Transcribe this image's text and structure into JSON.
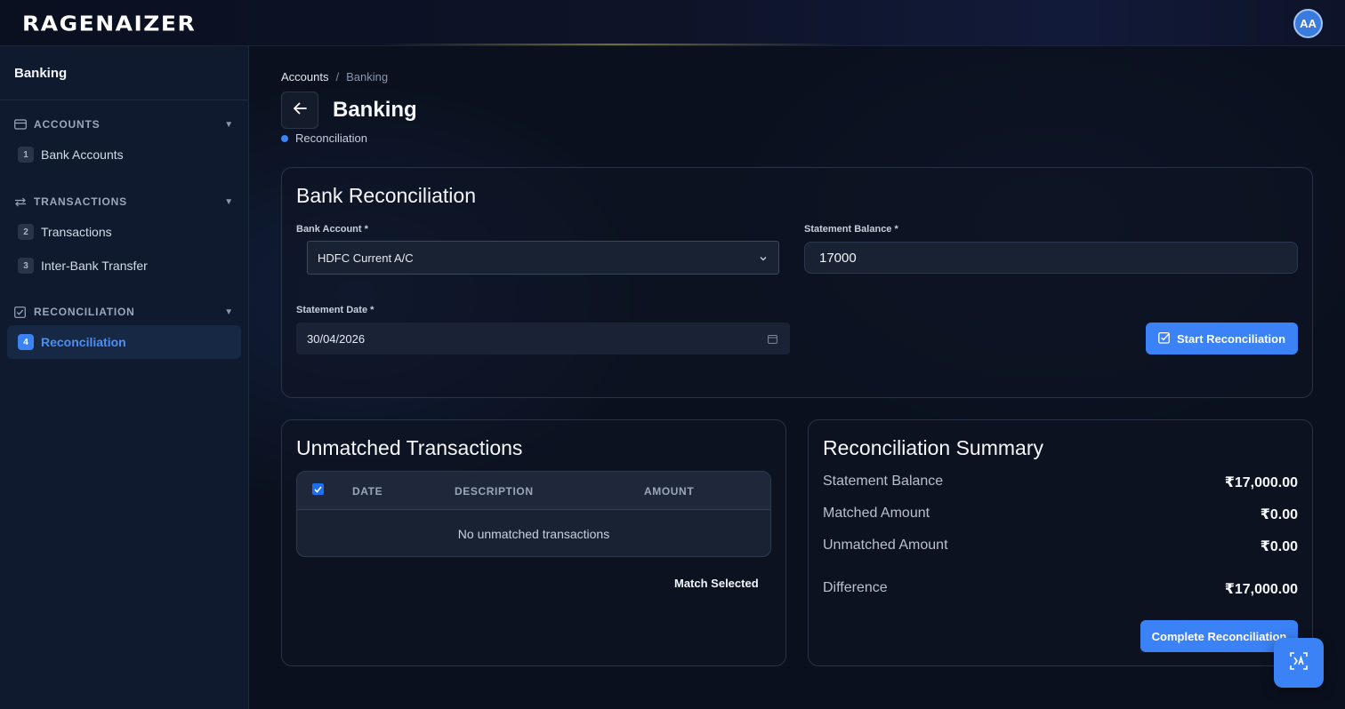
{
  "app": {
    "logo_text": "RAGENAIZER",
    "avatar_initials": "AA",
    "accent_color": "#3b82f6"
  },
  "sidebar": {
    "title": "Banking",
    "sections": [
      {
        "label": "ACCOUNTS",
        "icon": "card-icon",
        "items": [
          {
            "num": "1",
            "label": "Bank Accounts"
          }
        ]
      },
      {
        "label": "TRANSACTIONS",
        "icon": "transfer-arrows-icon",
        "items": [
          {
            "num": "2",
            "label": "Transactions"
          },
          {
            "num": "3",
            "label": "Inter-Bank Transfer"
          }
        ]
      },
      {
        "label": "RECONCILIATION",
        "icon": "checkbox-icon",
        "items": [
          {
            "num": "4",
            "label": "Reconciliation",
            "active": true
          }
        ]
      }
    ]
  },
  "breadcrumb": {
    "root": "Accounts",
    "separator": "/",
    "current": "Banking"
  },
  "page": {
    "title": "Banking",
    "subtab": "Reconciliation"
  },
  "reconciliation_form": {
    "title": "Bank Reconciliation",
    "bank_account_label": "Bank Account *",
    "bank_account_value": "HDFC Current A/C",
    "statement_balance_label": "Statement Balance *",
    "statement_balance_value": "17000",
    "statement_date_label": "Statement Date *",
    "statement_date_value": "30/04/2026",
    "start_button": "Start Reconciliation"
  },
  "unmatched": {
    "title": "Unmatched Transactions",
    "columns": [
      "DATE",
      "DESCRIPTION",
      "AMOUNT"
    ],
    "select_all_checked": true,
    "empty_message": "No unmatched transactions",
    "match_button": "Match Selected"
  },
  "summary": {
    "title": "Reconciliation Summary",
    "rows": [
      {
        "label": "Statement Balance",
        "value": "₹17,000.00"
      },
      {
        "label": "Matched Amount",
        "value": "₹0.00"
      },
      {
        "label": "Unmatched Amount",
        "value": "₹0.00"
      },
      {
        "label": "Difference",
        "value": "₹17,000.00"
      }
    ],
    "complete_button": "Complete Reconciliation"
  }
}
